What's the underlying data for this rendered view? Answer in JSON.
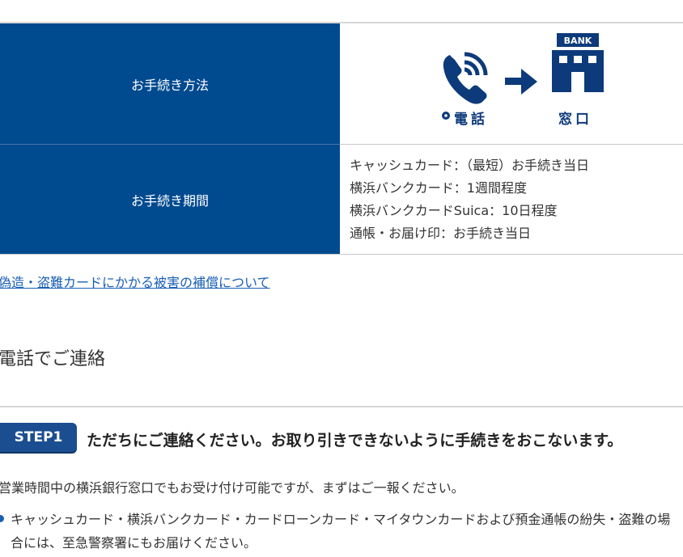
{
  "table": {
    "method_label": "お手続き方法",
    "method_icons": {
      "phone_caption": "電話",
      "bank_caption": "窓口",
      "bank_sign": "BANK"
    },
    "period_label": "お手続き期間",
    "periods": [
      "キャッシュカード：（最短）お手続き当日",
      "横浜バンクカード：1週間程度",
      "横浜バンクカードSuica：10日程度",
      "通帳・お届け印：お手続き当日"
    ]
  },
  "link_text": "偽造・盗難カードにかかる被害の補償について",
  "section_title": "電話でご連絡",
  "step": {
    "badge": "STEP1",
    "title": "ただちにご連絡ください。お取り引きできないように手続きをおこないます。"
  },
  "body_text": "営業時間中の横浜銀行窓口でもお受け付け可能ですが、まずはご一報ください。",
  "bullet_text": "キャッシュカード・横浜バンクカード・カードローンカード・マイタウンカードおよび預金通帳の紛失・盗難の場合には、至急警察署にもお届けください。",
  "colors": {
    "header_blue": "#004a8f",
    "icon_navy": "#0d3a7a",
    "link_blue": "#1a5fb4"
  }
}
